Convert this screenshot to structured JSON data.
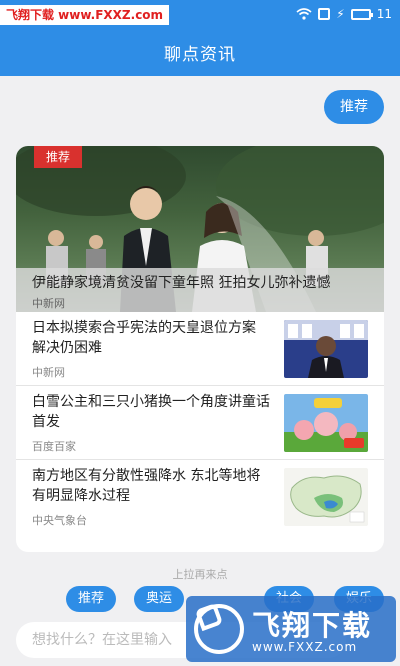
{
  "status_bar": {
    "watermark": "飞翔下载 www.FXXZ.com",
    "time": "11"
  },
  "header": {
    "title": "聊点资讯"
  },
  "chat": {
    "bubble": "推荐"
  },
  "news": {
    "hero": {
      "tag": "推荐",
      "title": "伊能静家境清贫没留下童年照 狂拍女儿弥补遗憾",
      "source": "中新网"
    },
    "items": [
      {
        "title": "日本拟摸索合乎宪法的天皇退位方案 解决仍困难",
        "source": "中新网",
        "thumb_icon": "press-conference-photo"
      },
      {
        "title": "白雪公主和三只小猪换一个角度讲童话首发",
        "source": "百度百家",
        "thumb_icon": "cartoon-poster-photo"
      },
      {
        "title": "南方地区有分散性强降水 东北等地将有明显降水过程",
        "source": "中央气象台",
        "thumb_icon": "weather-map-photo"
      }
    ]
  },
  "pull_hint": "上拉再来点",
  "chips": [
    "推荐",
    "奥运",
    "社会",
    "娱乐"
  ],
  "input": {
    "placeholder": "想找什么？在这里输入"
  },
  "watermark_logo": {
    "text": "飞翔下载",
    "url": "www.FXXZ.com"
  },
  "colors": {
    "primary": "#2e8de6",
    "tag_red": "#d9312e"
  }
}
